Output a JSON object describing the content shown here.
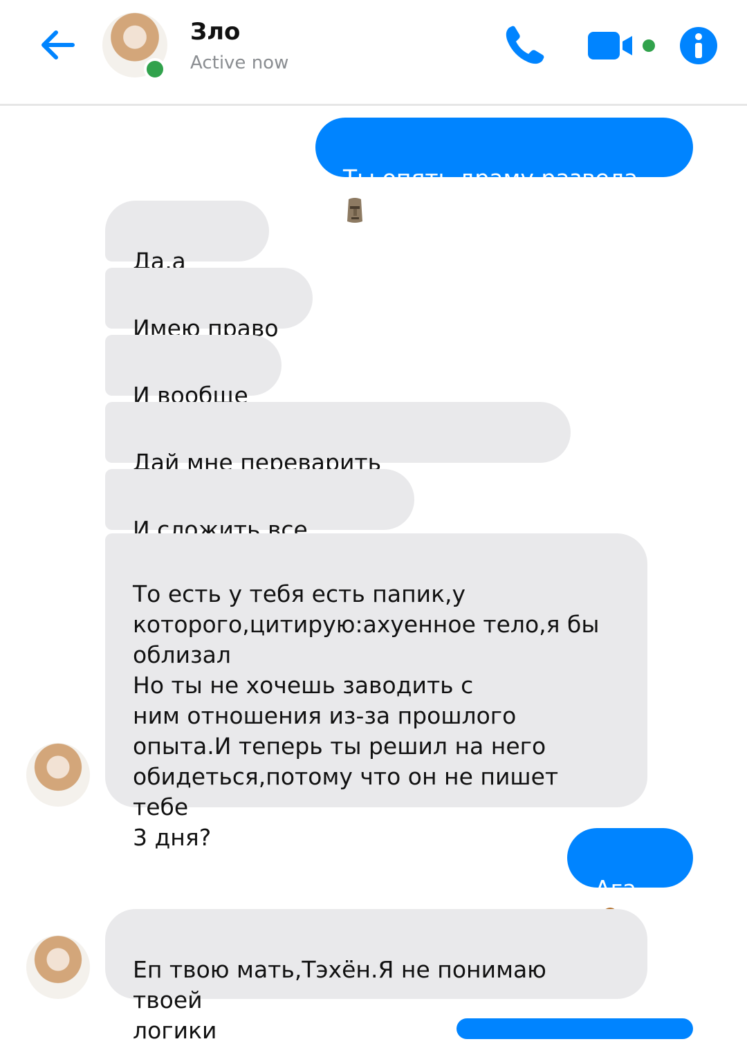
{
  "header": {
    "contact_name": "Зло",
    "status": "Active now",
    "icons": {
      "back": "back-arrow-icon",
      "call": "phone-icon",
      "video": "video-camera-icon",
      "info": "info-icon"
    },
    "accent_color": "#0084ff",
    "online_color": "#31a24c"
  },
  "messages": [
    {
      "direction": "out",
      "text": "Ты опять драму развела",
      "emoji": "moai-emoji"
    },
    {
      "direction": "in",
      "text": "Да,а что?"
    },
    {
      "direction": "in",
      "text": "Имею право"
    },
    {
      "direction": "in",
      "text": "И вообще"
    },
    {
      "direction": "in",
      "text": "Дай мне переварить информацию"
    },
    {
      "direction": "in",
      "text": "И сложить все пазлы"
    },
    {
      "direction": "in",
      "text": "То есть у тебя есть папик,у\nкоторого,цитирую:ахуенное тело,я бы\nоблизал\nНо ты не хочешь заводить с\nним отношения из-за прошлого\nопыта.И теперь ты решил на него\nобидеться,потому что он не пишет тебе\n3 дня?"
    },
    {
      "direction": "out",
      "text": "Ага",
      "emoji": "cowboy-emoji"
    },
    {
      "direction": "in",
      "text": "Еп твою мать,Тэхён.Я не понимаю твоей\nлогики"
    }
  ],
  "colors": {
    "outgoing_bubble": "#0084ff",
    "incoming_bubble": "#e9e9eb"
  }
}
